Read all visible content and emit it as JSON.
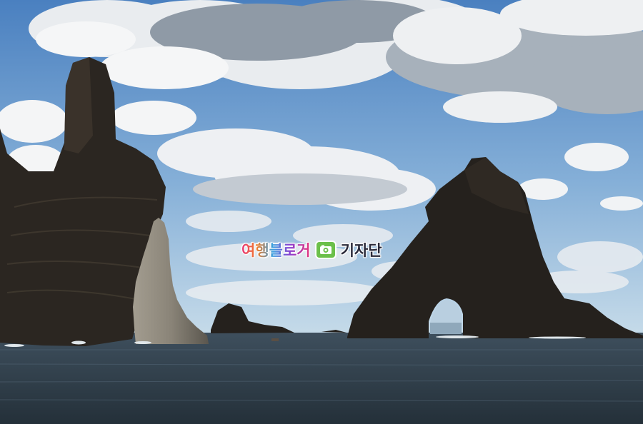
{
  "watermark": {
    "part1": "여행블로거",
    "icon": "camera-icon",
    "part2": "기자단"
  },
  "colors": {
    "sky_top": "#4f86c4",
    "sky_bottom": "#b9d3e6",
    "sea": "#2d3b47",
    "rock": "#2a2622",
    "pillar": "#8a8478",
    "icon_green": "#6cc04a"
  }
}
